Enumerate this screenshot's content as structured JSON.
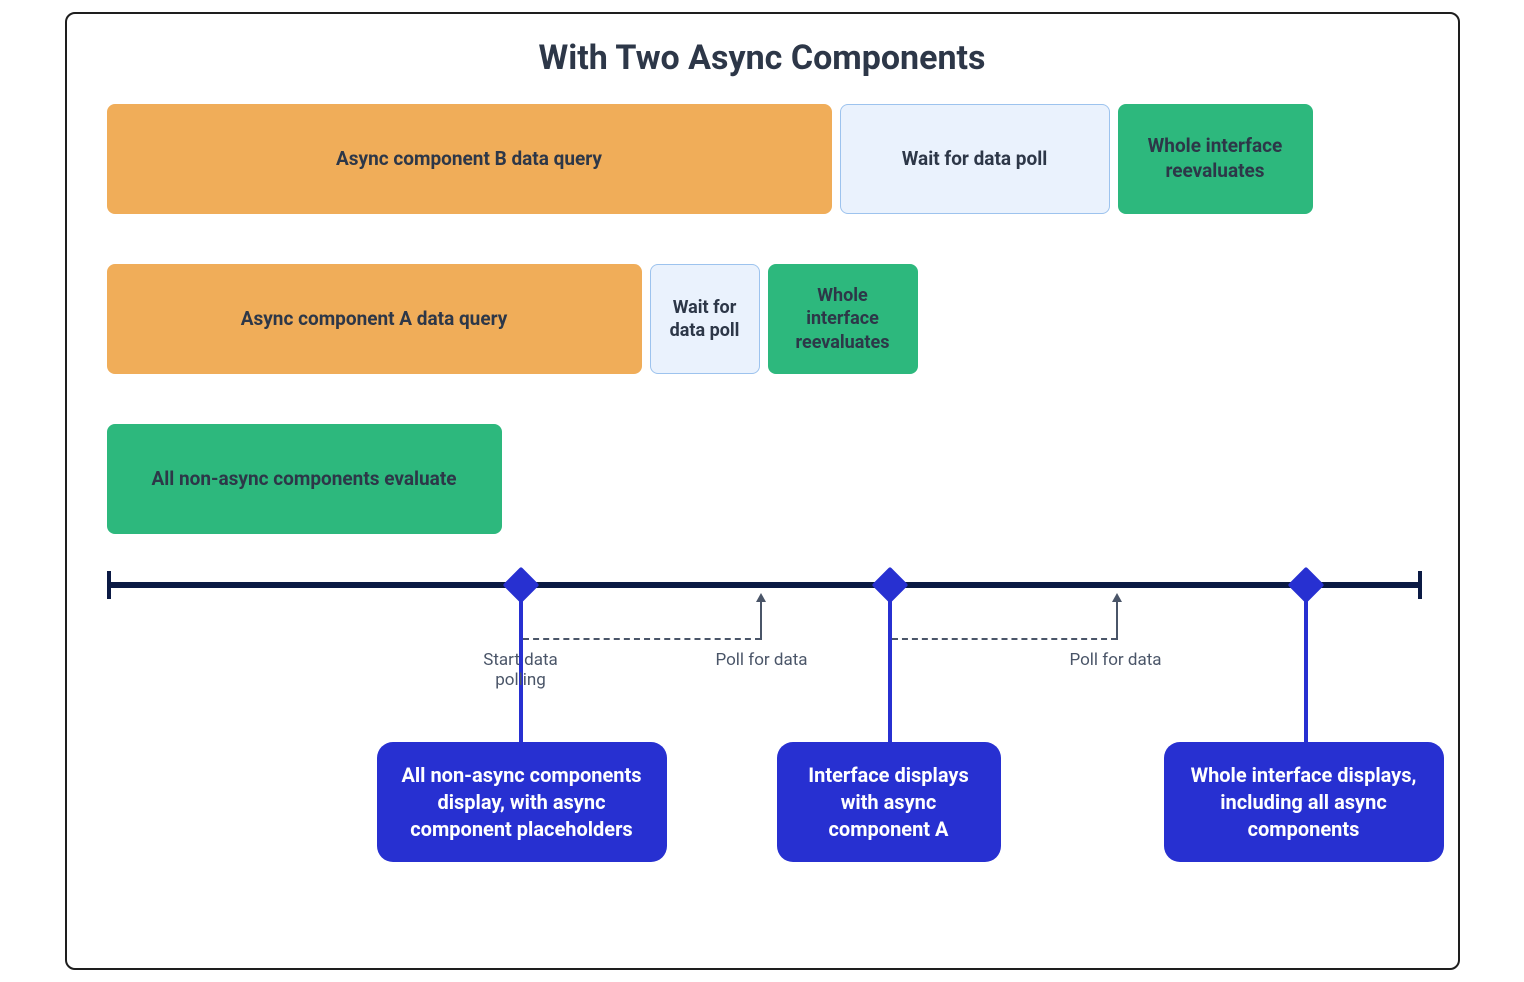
{
  "title": "With Two Async Components",
  "rows": {
    "b": {
      "query": "Async component B data query",
      "wait": "Wait for data poll",
      "reeval": "Whole interface reevaluates"
    },
    "a": {
      "query": "Async component A data query",
      "wait": "Wait for data poll",
      "reeval": "Whole interface reevaluates"
    },
    "nonasync": "All non-async components evaluate"
  },
  "labels": {
    "start_polling": "Start data polling",
    "poll1": "Poll for data",
    "poll2": "Poll for data"
  },
  "callouts": {
    "c1": "All non-async components display, with async component placeholders",
    "c2": "Interface displays with async component A",
    "c3": "Whole interface displays, including all async components"
  },
  "colors": {
    "orange": "#f0ad59",
    "lightblue": "#eaf2fd",
    "green": "#2db87d",
    "timeline": "#0b1a44",
    "accent": "#2730d1"
  }
}
